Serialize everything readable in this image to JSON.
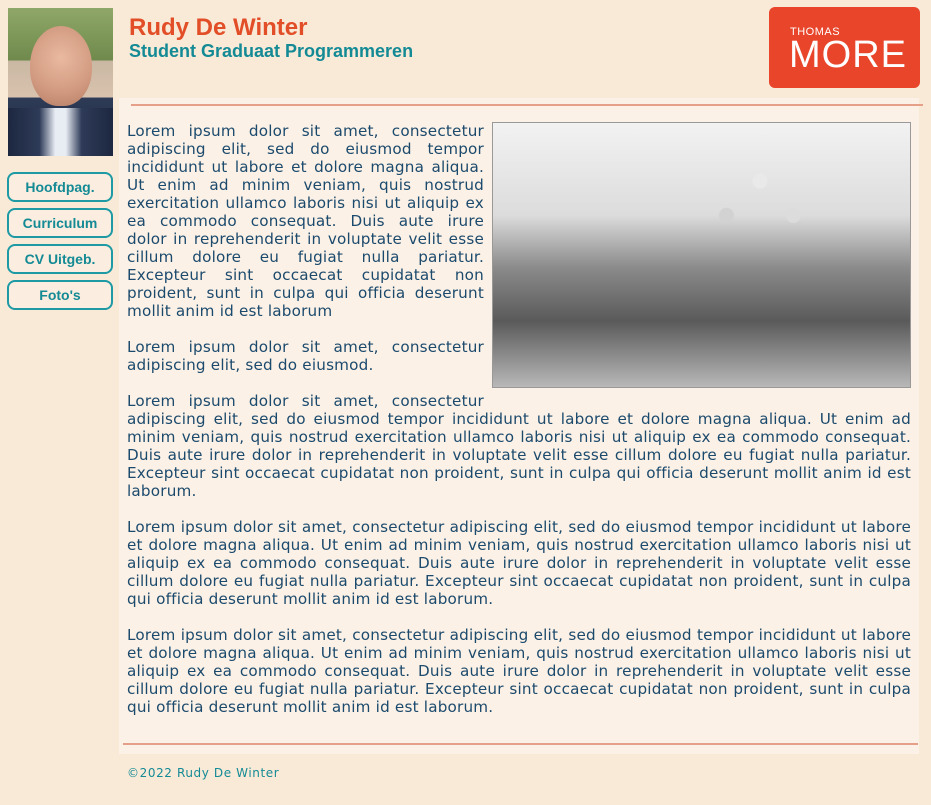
{
  "header": {
    "name": "Rudy De Winter",
    "subtitle": "Student Graduaat Programmeren",
    "logo_small": "THOMAS",
    "logo_main": "MORE"
  },
  "nav": [
    {
      "label": "Hoofdpag."
    },
    {
      "label": "Curriculum"
    },
    {
      "label": "CV Uitgeb."
    },
    {
      "label": "Foto's"
    }
  ],
  "main": {
    "p1": "Lorem ipsum dolor sit amet, consectetur adipiscing elit, sed do eiusmod tempor incididunt ut labore et dolore magna aliqua. Ut enim ad minim veniam, quis nostrud exercitation ullamco laboris nisi ut aliquip ex ea commodo consequat. Duis aute irure dolor in reprehenderit in voluptate velit esse cillum dolore eu fugiat nulla pariatur. Excepteur sint occaecat cupidatat non proident, sunt in culpa qui officia deserunt mollit anim id est laborum",
    "p2": "Lorem ipsum dolor sit amet, consectetur adipiscing elit, sed do eiusmod.",
    "p3": "Lorem ipsum dolor sit amet, consectetur adipiscing elit, sed do eiusmod tempor incididunt ut labore et dolore magna aliqua. Ut enim ad minim veniam, quis nostrud exercitation ullamco laboris nisi ut aliquip ex ea commodo consequat. Duis aute irure dolor in reprehenderit in voluptate velit esse cillum dolore eu fugiat nulla pariatur. Excepteur sint occaecat cupidatat non proident, sunt in culpa qui officia deserunt mollit anim id est laborum.",
    "p4": "Lorem ipsum dolor sit amet, consectetur adipiscing elit, sed do eiusmod tempor incididunt ut labore et dolore magna aliqua. Ut enim ad minim veniam, quis nostrud exercitation ullamco laboris nisi ut aliquip ex ea commodo consequat. Duis aute irure dolor in reprehenderit in voluptate velit esse cillum dolore eu fugiat nulla pariatur. Excepteur sint occaecat cupidatat non proident, sunt in culpa qui officia deserunt mollit anim id est laborum.",
    "p5": "Lorem ipsum dolor sit amet, consectetur adipiscing elit, sed do eiusmod tempor incididunt ut labore et dolore magna aliqua. Ut enim ad minim veniam, quis nostrud exercitation ullamco laboris nisi ut aliquip ex ea commodo consequat. Duis aute irure dolor in reprehenderit in voluptate velit esse cillum dolore eu fugiat nulla pariatur. Excepteur sint occaecat cupidatat non proident, sunt in culpa qui officia deserunt mollit anim id est laborum."
  },
  "footer": {
    "text": "©2022 Rudy De Winter"
  },
  "colors": {
    "background": "#f9ead8",
    "accent_orange": "#e24e27",
    "accent_teal": "#148a95",
    "text_blue": "#1c4a6d",
    "logo_red": "#e8452a"
  }
}
